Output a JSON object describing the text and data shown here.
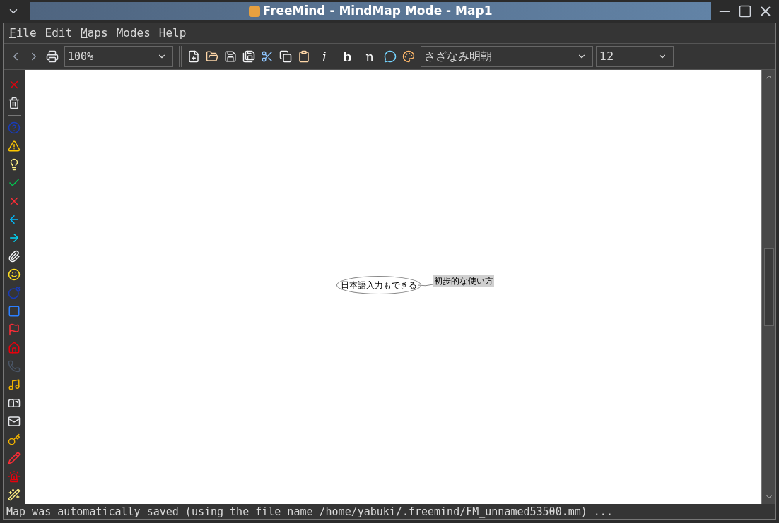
{
  "window": {
    "title": "FreeMind - MindMap Mode - Map1"
  },
  "menu": [
    {
      "label": "File",
      "first_letter_underlined": true
    },
    {
      "label": "Edit",
      "first_letter_underlined": false
    },
    {
      "label": "Maps",
      "first_letter_underlined": true
    },
    {
      "label": "Modes",
      "first_letter_underlined": false
    },
    {
      "label": "Help",
      "first_letter_underlined": false
    }
  ],
  "toolbar": {
    "zoom": "100%",
    "format_buttons": [
      "i",
      "b",
      "n"
    ],
    "font_family": "さざなみ明朝",
    "font_size": "12"
  },
  "map": {
    "root": {
      "text": "日本語入力もできる",
      "children": [
        {
          "text": "初歩的な使い方",
          "selected": true
        }
      ]
    }
  },
  "status_bar": "Map was automatically saved (using the file name /home/yabuki/.freemind/FM_unnamed53500.mm) ..."
}
